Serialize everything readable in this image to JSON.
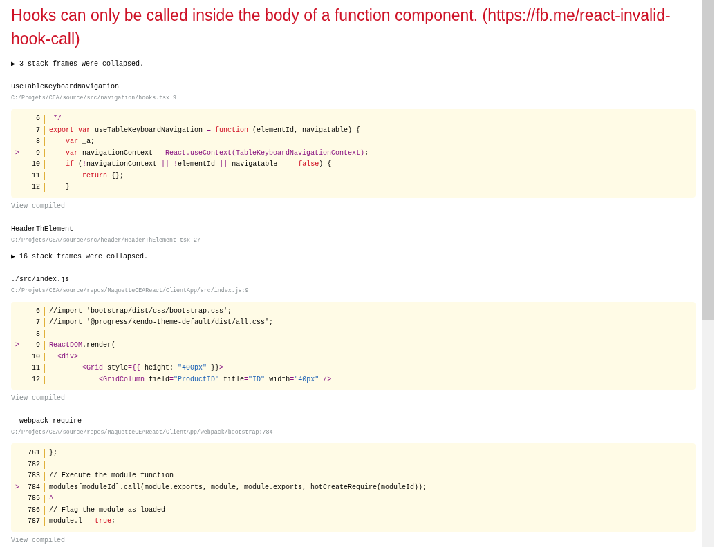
{
  "error": {
    "message": "Hooks can only be called inside the body of a function component. (https://fb.me/react-invalid-hook-call)"
  },
  "stack": [
    {
      "kind": "collapsed",
      "toggle": "▶",
      "text": "3 stack frames were collapsed."
    },
    {
      "kind": "frame",
      "function": "useTableKeyboardNavigation",
      "location": "C:/Projets/CEA/source/src/navigation/hooks.tsx:9",
      "link": "View compiled",
      "code": [
        {
          "number": "6",
          "segments": [
            {
              "text": " */",
              "kind": "name"
            }
          ]
        },
        {
          "number": "7",
          "segments": [
            {
              "text": "export var",
              "kind": "keyword"
            },
            {
              "text": " useTableKeyboardNavigation ",
              "kind": "plain"
            },
            {
              "text": "=",
              "kind": "operator"
            },
            {
              "text": " function",
              "kind": "keyword"
            },
            {
              "text": " (elementId, navigatable) {",
              "kind": "plain"
            }
          ]
        },
        {
          "number": "8",
          "segments": [
            {
              "text": "    var",
              "kind": "keyword"
            },
            {
              "text": " _a;",
              "kind": "plain"
            }
          ]
        },
        {
          "number": "9",
          "marker": ">",
          "segments": [
            {
              "text": "    var",
              "kind": "keyword"
            },
            {
              "text": " navigationContext ",
              "kind": "plain"
            },
            {
              "text": "=",
              "kind": "operator"
            },
            {
              "text": " React.useContext(TableKeyboardNavigationContext)",
              "kind": "name"
            },
            {
              "text": ";",
              "kind": "plain"
            }
          ]
        },
        {
          "number": "10",
          "segments": [
            {
              "text": "    if",
              "kind": "keyword"
            },
            {
              "text": " (",
              "kind": "plain"
            },
            {
              "text": "!",
              "kind": "operator"
            },
            {
              "text": "navigationContext ",
              "kind": "plain"
            },
            {
              "text": "||",
              "kind": "operator"
            },
            {
              "text": " !",
              "kind": "operator"
            },
            {
              "text": "elementId ",
              "kind": "plain"
            },
            {
              "text": "||",
              "kind": "operator"
            },
            {
              "text": " navigatable ",
              "kind": "plain"
            },
            {
              "text": "===",
              "kind": "operator"
            },
            {
              "text": " false",
              "kind": "keyword"
            },
            {
              "text": ") {",
              "kind": "plain"
            }
          ]
        },
        {
          "number": "11",
          "segments": [
            {
              "text": "        return",
              "kind": "keyword"
            },
            {
              "text": " {};",
              "kind": "plain"
            }
          ]
        },
        {
          "number": "12",
          "segments": [
            {
              "text": "    }",
              "kind": "plain"
            }
          ]
        }
      ]
    },
    {
      "kind": "frame",
      "function": "HeaderThElement",
      "location": "C:/Projets/CEA/source/src/header/HeaderThElement.tsx:27"
    },
    {
      "kind": "collapsed",
      "toggle": "▶",
      "text": "16 stack frames were collapsed."
    },
    {
      "kind": "frame",
      "function": "./src/index.js",
      "location": "C:/Projets/CEA/source/repos/MaquetteCEAReact/ClientApp/src/index.js:9",
      "link": "View compiled",
      "code": [
        {
          "number": "6",
          "segments": [
            {
              "text": "//import 'bootstrap/dist/css/bootstrap.css';",
              "kind": "plain"
            }
          ]
        },
        {
          "number": "7",
          "segments": [
            {
              "text": "//import '@progress/kendo-theme-default/dist/all.css';",
              "kind": "plain"
            }
          ]
        },
        {
          "number": "8"
        },
        {
          "number": "9",
          "marker": ">",
          "segments": [
            {
              "text": "ReactDOM",
              "kind": "name"
            },
            {
              "text": ".render(",
              "kind": "plain"
            }
          ]
        },
        {
          "number": "10",
          "segments": [
            {
              "text": "  <div>",
              "kind": "name"
            }
          ]
        },
        {
          "number": "11",
          "segments": [
            {
              "text": "        <Grid",
              "kind": "name"
            },
            {
              "text": " style",
              "kind": "plain"
            },
            {
              "text": "={{",
              "kind": "operator"
            },
            {
              "text": " height: ",
              "kind": "plain"
            },
            {
              "text": "\"400px\"",
              "kind": "string"
            },
            {
              "text": " }}",
              "kind": "plain"
            },
            {
              "text": ">",
              "kind": "name"
            }
          ]
        },
        {
          "number": "12",
          "segments": [
            {
              "text": "            <GridColumn",
              "kind": "name"
            },
            {
              "text": " field",
              "kind": "plain"
            },
            {
              "text": "=",
              "kind": "operator"
            },
            {
              "text": "\"ProductID\"",
              "kind": "string"
            },
            {
              "text": " title",
              "kind": "plain"
            },
            {
              "text": "=",
              "kind": "operator"
            },
            {
              "text": "\"ID\"",
              "kind": "string"
            },
            {
              "text": " width",
              "kind": "plain"
            },
            {
              "text": "=",
              "kind": "operator"
            },
            {
              "text": "\"40px\"",
              "kind": "string"
            },
            {
              "text": " />",
              "kind": "name"
            }
          ]
        }
      ]
    },
    {
      "kind": "frame",
      "function": "__webpack_require__",
      "location": "C:/Projets/CEA/source/repos/MaquetteCEAReact/ClientApp/webpack/bootstrap:784",
      "link": "View compiled",
      "code": [
        {
          "number": "781",
          "segments": [
            {
              "text": "};",
              "kind": "plain"
            }
          ]
        },
        {
          "number": "782"
        },
        {
          "number": "783",
          "segments": [
            {
              "text": "// Execute the module function",
              "kind": "plain"
            }
          ]
        },
        {
          "number": "784",
          "marker": ">",
          "segments": [
            {
              "text": "modules[moduleId].call(module.exports, module, module.exports, hotCreateRequire(moduleId));",
              "kind": "plain"
            }
          ]
        },
        {
          "number": "785",
          "segments": [
            {
              "text": "^",
              "kind": "name"
            }
          ]
        },
        {
          "number": "786",
          "segments": [
            {
              "text": "// Flag the module as loaded",
              "kind": "plain"
            }
          ]
        },
        {
          "number": "787",
          "segments": [
            {
              "text": "module.l ",
              "kind": "plain"
            },
            {
              "text": "=",
              "kind": "operator"
            },
            {
              "text": " true",
              "kind": "keyword"
            },
            {
              "text": ";",
              "kind": "plain"
            }
          ]
        }
      ]
    }
  ]
}
